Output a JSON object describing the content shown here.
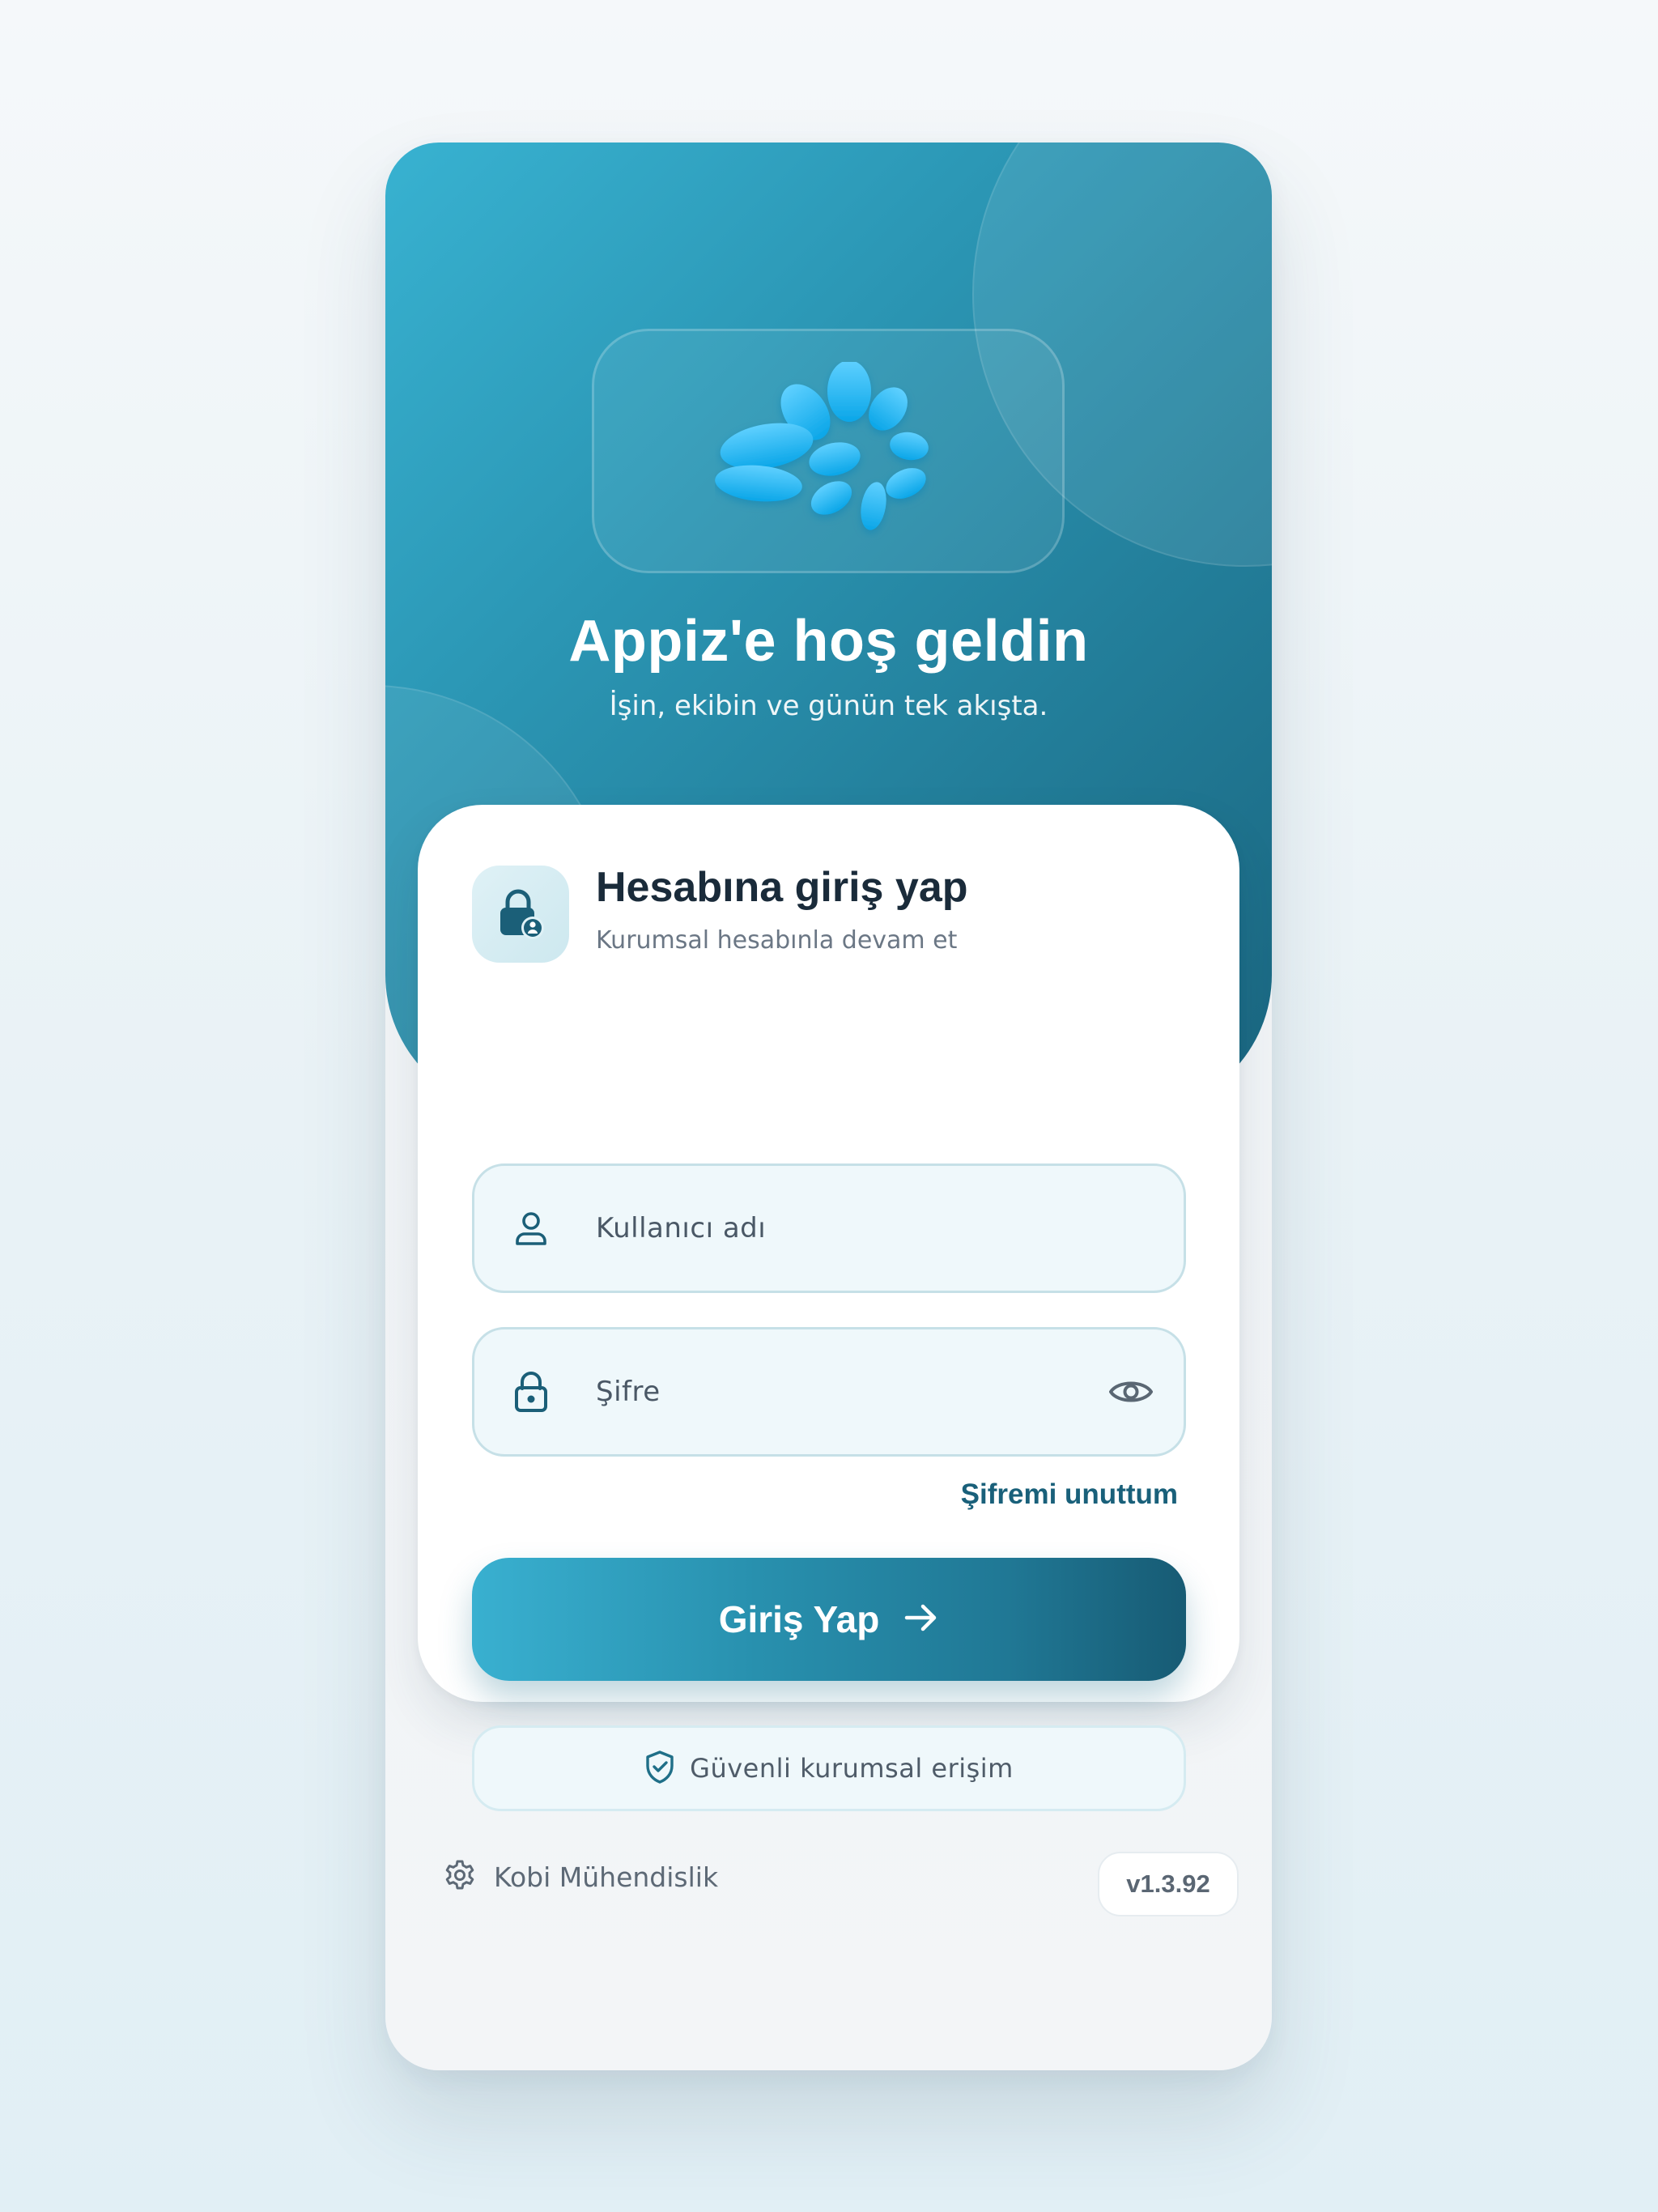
{
  "hero": {
    "title": "Appiz'e hoş geldin",
    "subtitle": "İşin, ekibin ve günün tek akışta.",
    "logo_icon": "appiz-logo"
  },
  "card": {
    "icon": "lock-user-icon",
    "title": "Hesabına giriş yap",
    "subtitle": "Kurumsal hesabınla devam et"
  },
  "form": {
    "username": {
      "placeholder": "Kullanıcı adı",
      "value": "",
      "icon": "user-icon"
    },
    "password": {
      "placeholder": "Şifre",
      "value": "",
      "icon": "lock-icon",
      "toggle_icon": "eye-icon"
    },
    "forgot_label": "Şifremi unuttum",
    "submit_label": "Giriş Yap",
    "submit_icon": "arrow-right-icon"
  },
  "security": {
    "label": "Güvenli kurumsal erişim",
    "icon": "shield-check-icon"
  },
  "footer": {
    "brand": "Kobi Mühendislik",
    "brand_icon": "gear-icon",
    "version": "v1.3.92"
  },
  "colors": {
    "primary": "#2b96b4",
    "primary_dark": "#175b74",
    "primary_light": "#39b0d0",
    "text_dark": "#1a2b3a",
    "text_muted": "#6b7785",
    "link": "#19607a"
  }
}
